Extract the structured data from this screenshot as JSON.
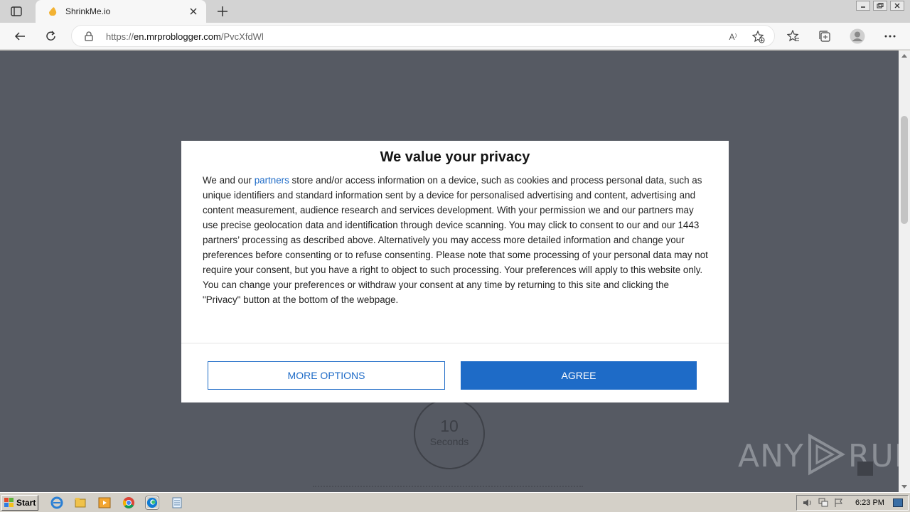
{
  "browser": {
    "tab_title": "ShrinkMe.io",
    "url_prefix": "https://",
    "url_host": "en.mrproblogger.com",
    "url_path": "/PvcXfdWl",
    "read_aloud_label": "A⁾"
  },
  "consent": {
    "title": "We value your privacy",
    "body_start": "We and our ",
    "partners_link": "partners",
    "body_rest": " store and/or access information on a device, such as cookies and process personal data, such as unique identifiers and standard information sent by a device for personalised advertising and content, advertising and content measurement, audience research and services development. With your permission we and our partners may use precise geolocation data and identification through device scanning. You may click to consent to our and our 1443 partners’ processing as described above. Alternatively you may access more detailed information and change your preferences before consenting or to refuse consenting. Please note that some processing of your personal data may not require your consent, but you have a right to object to such processing. Your preferences will apply to this website only. You can change your preferences or withdraw your consent at any time by returning to this site and clicking the \"Privacy\" button at the bottom of the webpage.",
    "more_options_label": "MORE OPTIONS",
    "agree_label": "AGREE"
  },
  "page": {
    "countdown_value": "10",
    "countdown_unit": "Seconds"
  },
  "watermark": {
    "left": "ANY",
    "right": "RUN"
  },
  "taskbar": {
    "start_label": "Start",
    "clock": "6:23 PM"
  },
  "colors": {
    "accent": "#1e6bc7",
    "page_background": "#565a63"
  }
}
